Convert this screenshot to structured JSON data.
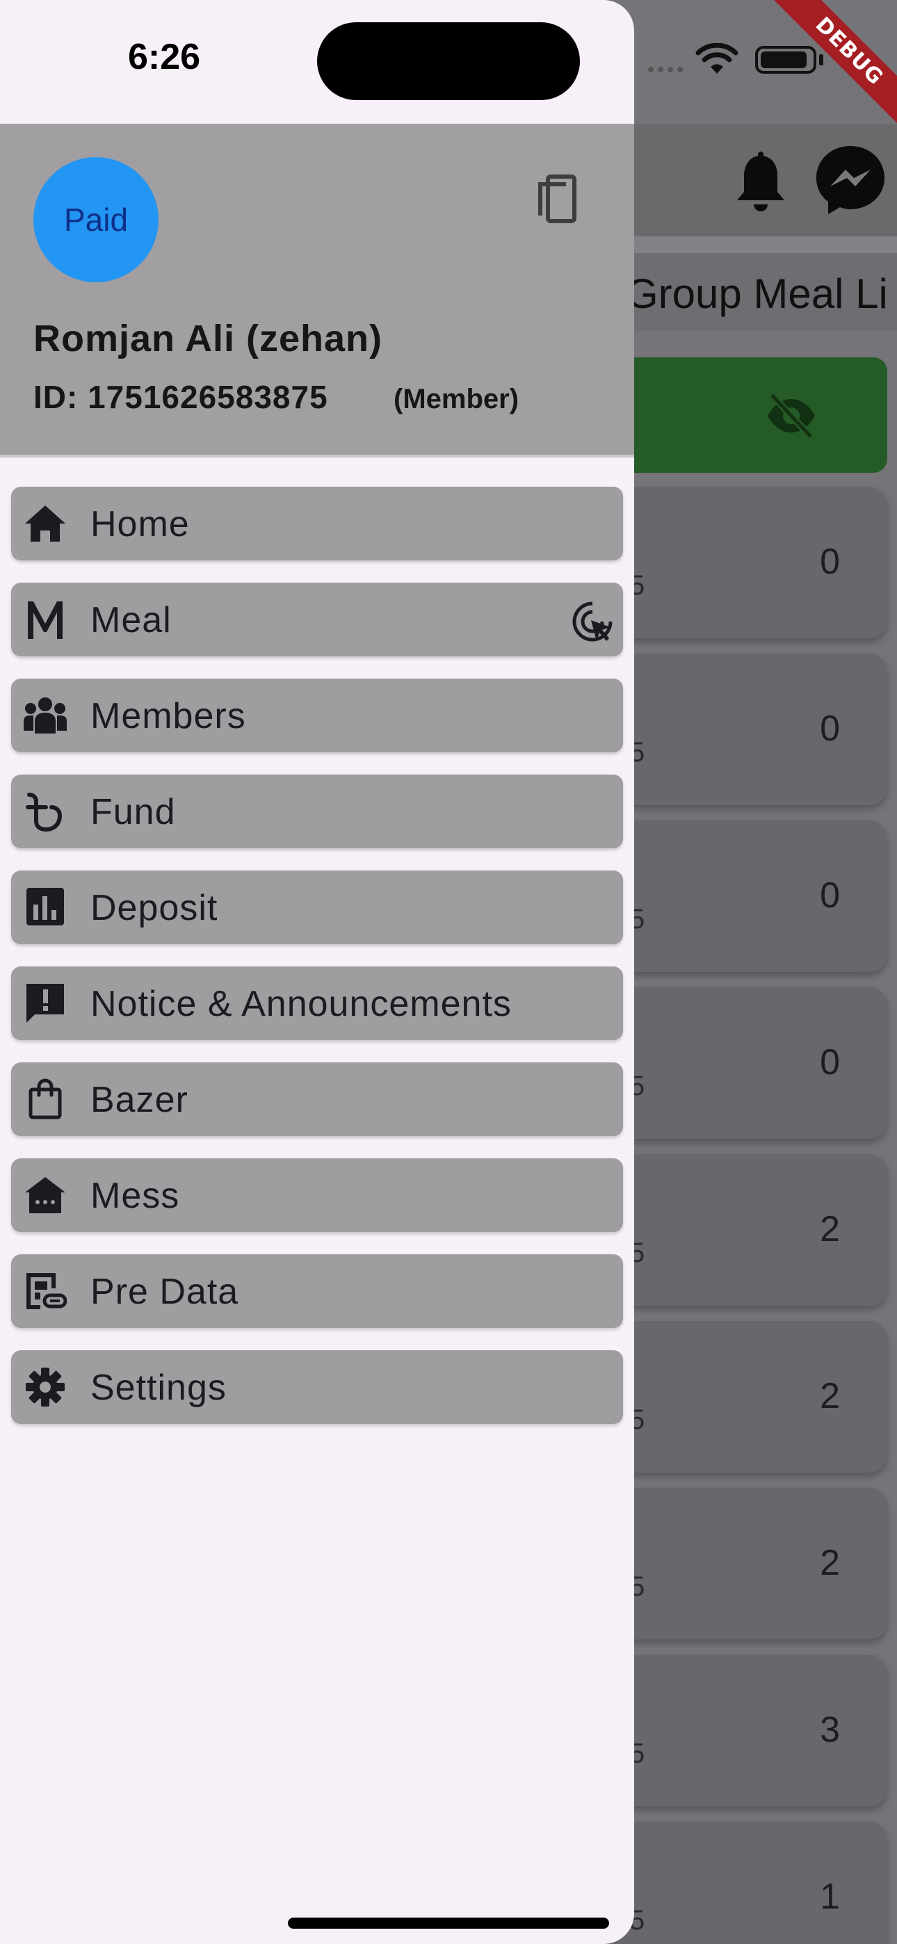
{
  "status_bar": {
    "time": "6:26"
  },
  "debug_banner": "DEBUG",
  "background": {
    "tab_label": "Group Meal Li",
    "rows": [
      {
        "value": "0",
        "sub": "5"
      },
      {
        "value": "0",
        "sub": "5"
      },
      {
        "value": "0",
        "sub": "5"
      },
      {
        "value": "0",
        "sub": "5"
      },
      {
        "value": "2",
        "sub": "5"
      },
      {
        "value": "2",
        "sub": "5"
      },
      {
        "value": "2",
        "sub": "5"
      },
      {
        "value": "3",
        "sub": "5"
      },
      {
        "value": "1",
        "sub": "5"
      }
    ]
  },
  "drawer": {
    "header": {
      "avatar_label": "Paid",
      "name": "Romjan Ali (zehan)",
      "id_text": "ID: 1751626583875",
      "role": "(Member)"
    },
    "items": [
      {
        "label": "Home",
        "icon": "home-icon"
      },
      {
        "label": "Meal",
        "icon": "meal-m-icon",
        "trailing_icon": "ads-click-icon"
      },
      {
        "label": "Members",
        "icon": "groups-icon"
      },
      {
        "label": "Fund",
        "icon": "taka-icon"
      },
      {
        "label": "Deposit",
        "icon": "bar-chart-icon"
      },
      {
        "label": "Notice & Announcements",
        "icon": "announcement-icon"
      },
      {
        "label": "Bazer",
        "icon": "shopping-bag-icon"
      },
      {
        "label": "Mess",
        "icon": "house-icon"
      },
      {
        "label": "Pre Data",
        "icon": "data-link-icon"
      },
      {
        "label": "Settings",
        "icon": "gear-icon"
      }
    ]
  },
  "colors": {
    "avatar": "#2395f3",
    "green_card": "#255b27",
    "drawer_bg": "#f7f0f8",
    "menu_item_bg": "#9f9da0"
  }
}
